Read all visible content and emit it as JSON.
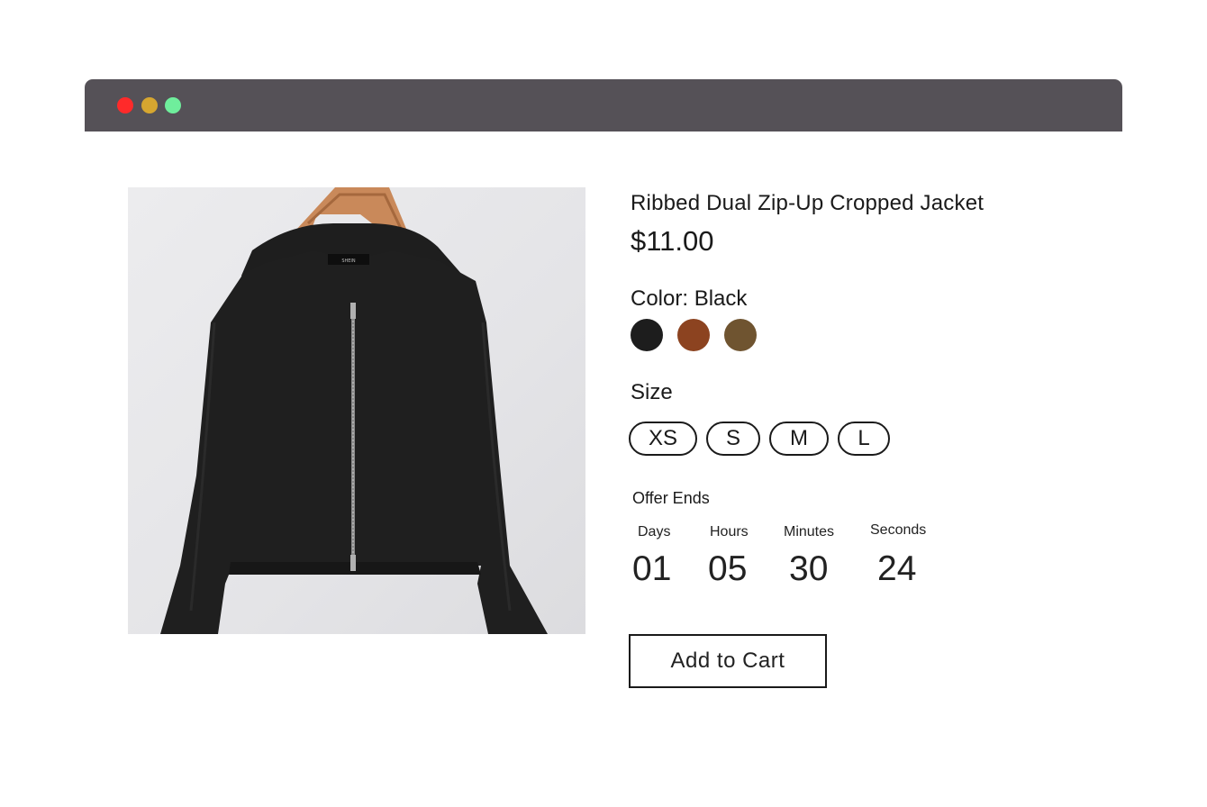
{
  "window": {
    "controls": [
      {
        "name": "close",
        "color": "#ff2a2a"
      },
      {
        "name": "minimize",
        "color": "#d6a630"
      },
      {
        "name": "maximize",
        "color": "#6fee9c"
      }
    ]
  },
  "product": {
    "title": "Ribbed Dual Zip-Up Cropped Jacket",
    "price": "$11.00",
    "image_icon": "hooded-zip-jacket-on-hanger",
    "brand_tag": "SHEIN"
  },
  "color": {
    "label": "Color: Black",
    "swatches": [
      {
        "name": "black",
        "hex": "#1d1d1d"
      },
      {
        "name": "rust-brown",
        "hex": "#8c4320"
      },
      {
        "name": "olive-brown",
        "hex": "#6f5430"
      }
    ]
  },
  "size": {
    "label": "Size",
    "options": [
      "XS",
      "S",
      "M",
      "L"
    ]
  },
  "offer": {
    "label": "Offer Ends",
    "units": [
      {
        "label": "Days",
        "value": "01"
      },
      {
        "label": "Hours",
        "value": "05"
      },
      {
        "label": "Minutes",
        "value": "30"
      },
      {
        "label": "Seconds",
        "value": "24"
      }
    ]
  },
  "cart": {
    "label": "Add to Cart"
  }
}
